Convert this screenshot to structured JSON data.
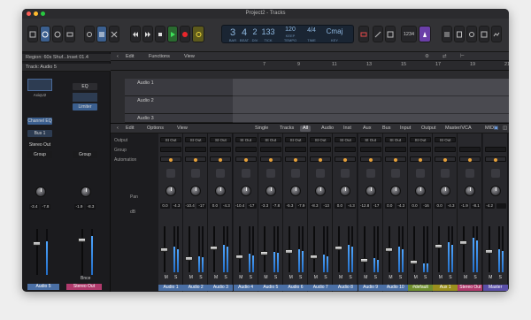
{
  "window": {
    "title": "Project2 - Tracks"
  },
  "lcd": {
    "bar": "3",
    "beat": "4",
    "div": "2",
    "tick": "133",
    "tempo": "120",
    "tempo_label": "KEEP",
    "time_sig": "4/4",
    "key": "Cmaj",
    "bar_label": "BAR",
    "beat_label": "BEAT",
    "div_label": "DIV",
    "tick_label": "TICK",
    "tempo_sub": "TEMPO",
    "sig_sub": "TIME",
    "key_sub": "KEY"
  },
  "toolbar": {
    "count_in": "1234",
    "cpu_label": "♩=120"
  },
  "inspector": {
    "region": "Region: 60s Shuf...Inset 01.4",
    "track": "Track: Audio 5",
    "eq_label": "EQ",
    "limiter": "Limiter",
    "axiom": "AxiqU2",
    "ch_eq": "Channel EQ",
    "bus": "Bus 1",
    "stereo_out": "Stereo Out",
    "group": "Group",
    "bnce": "Bnce",
    "left_name": "Audio 5",
    "right_name": "Stereo Out",
    "left_vals": [
      "-3.4",
      "-7.8"
    ],
    "right_vals": [
      "-1.9",
      "-8.3"
    ]
  },
  "tracks_bar": {
    "edit": "Edit",
    "functions": "Functions",
    "view": "View"
  },
  "ruler": {
    "ticks": [
      "7",
      "9",
      "11",
      "13",
      "15",
      "17",
      "19",
      "21"
    ]
  },
  "tracks": [
    {
      "name": "Audio 1"
    },
    {
      "name": "Audio 2"
    },
    {
      "name": "Audio 3"
    }
  ],
  "mixer_bar": {
    "edit": "Edit",
    "options": "Options",
    "view": "View",
    "filters": [
      "Single",
      "Tracks",
      "All",
      "Audio",
      "Inst",
      "Aux",
      "Bus",
      "Input",
      "Output",
      "Master/VCA",
      "MIDI"
    ],
    "active_filter": "All"
  },
  "mixer_labels": {
    "output": "Output",
    "group": "Group",
    "automation": "Automation",
    "pan": "Pan",
    "db": "dB"
  },
  "strips": [
    {
      "name": "Audio 1",
      "out": "St Out",
      "vals": [
        "0.0",
        "-4.3"
      ],
      "name_bg": "#4a6fa5"
    },
    {
      "name": "Audio 2",
      "out": "St Out",
      "vals": [
        "-10.4",
        "-17"
      ],
      "name_bg": "#4a6fa5"
    },
    {
      "name": "Audio 3",
      "out": "St Out",
      "vals": [
        "0.0",
        "-4.3"
      ],
      "name_bg": "#4a6fa5"
    },
    {
      "name": "Audio 4",
      "out": "St Out",
      "vals": [
        "-10.4",
        "-17"
      ],
      "name_bg": "#4a6fa5"
    },
    {
      "name": "Audio 5",
      "out": "St Out",
      "vals": [
        "-3.3",
        "-7.8"
      ],
      "name_bg": "#4a6fa5"
    },
    {
      "name": "Audio 6",
      "out": "St Out",
      "vals": [
        "-5.3",
        "-7.9"
      ],
      "name_bg": "#4a6fa5"
    },
    {
      "name": "Audio 7",
      "out": "St Out",
      "vals": [
        "-8.3",
        "-13"
      ],
      "name_bg": "#4a6fa5"
    },
    {
      "name": "Audio 8",
      "out": "St Out",
      "vals": [
        "0.0",
        "-4.3"
      ],
      "name_bg": "#4a6fa5"
    },
    {
      "name": "Audio 9",
      "out": "St Out",
      "vals": [
        "-12.8",
        "-17"
      ],
      "name_bg": "#4a6fa5"
    },
    {
      "name": "Audio 10",
      "out": "St Out",
      "vals": [
        "0.0",
        "-4.3"
      ],
      "name_bg": "#4a6fa5"
    },
    {
      "name": "#default",
      "out": "St Out",
      "vals": [
        "0.0",
        "-16"
      ],
      "name_bg": "#6f8f2f"
    },
    {
      "name": "Aux 1",
      "out": "St Out",
      "vals": [
        "0.0",
        "-4.3"
      ],
      "name_bg": "#9a8f1e"
    },
    {
      "name": "Stereo Out",
      "out": "",
      "vals": [
        "-1.9",
        "-8.1"
      ],
      "name_bg": "#b03a6c"
    },
    {
      "name": "Master",
      "out": "",
      "vals": [
        "-4.2",
        ""
      ],
      "name_bg": "#5a4fa8"
    }
  ]
}
